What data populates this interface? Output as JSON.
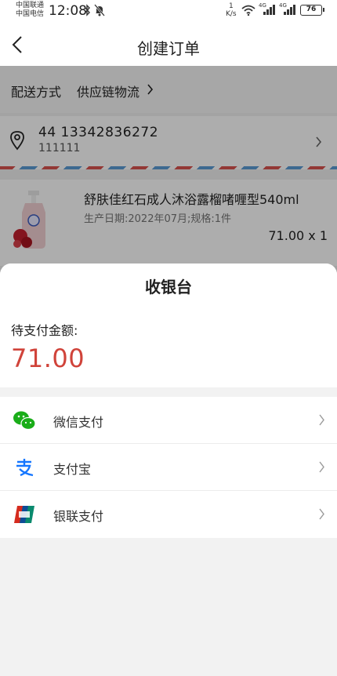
{
  "status_bar": {
    "carrier1": "中国联通",
    "carrier2": "中国电信",
    "time": "12:08",
    "speed_value": "1",
    "speed_unit": "K/s",
    "net1": "4G",
    "net2": "4G",
    "battery": "76"
  },
  "header": {
    "title": "创建订单"
  },
  "order": {
    "delivery_label": "配送方式",
    "delivery_value": "供应链物流",
    "address_line1": "44  13342836272",
    "address_line2": "111111",
    "product_name": "舒肤佳红石成人沐浴露榴啫喱型540ml",
    "product_meta": "生产日期:2022年07月;规格:1件",
    "product_price": "71.00 x 1"
  },
  "cashier": {
    "title": "收银台",
    "amount_label": "待支付金额:",
    "amount": "71.00",
    "methods": [
      {
        "label": "微信支付",
        "icon": "wechat-pay-icon",
        "color": "#1aad19"
      },
      {
        "label": "支付宝",
        "icon": "alipay-icon",
        "color": "#1677ff"
      },
      {
        "label": "银联支付",
        "icon": "unionpay-icon",
        "color": "#d52b1e"
      }
    ]
  },
  "colors": {
    "amount": "#d0433a",
    "overlay": "rgba(0,0,0,0.32)"
  }
}
